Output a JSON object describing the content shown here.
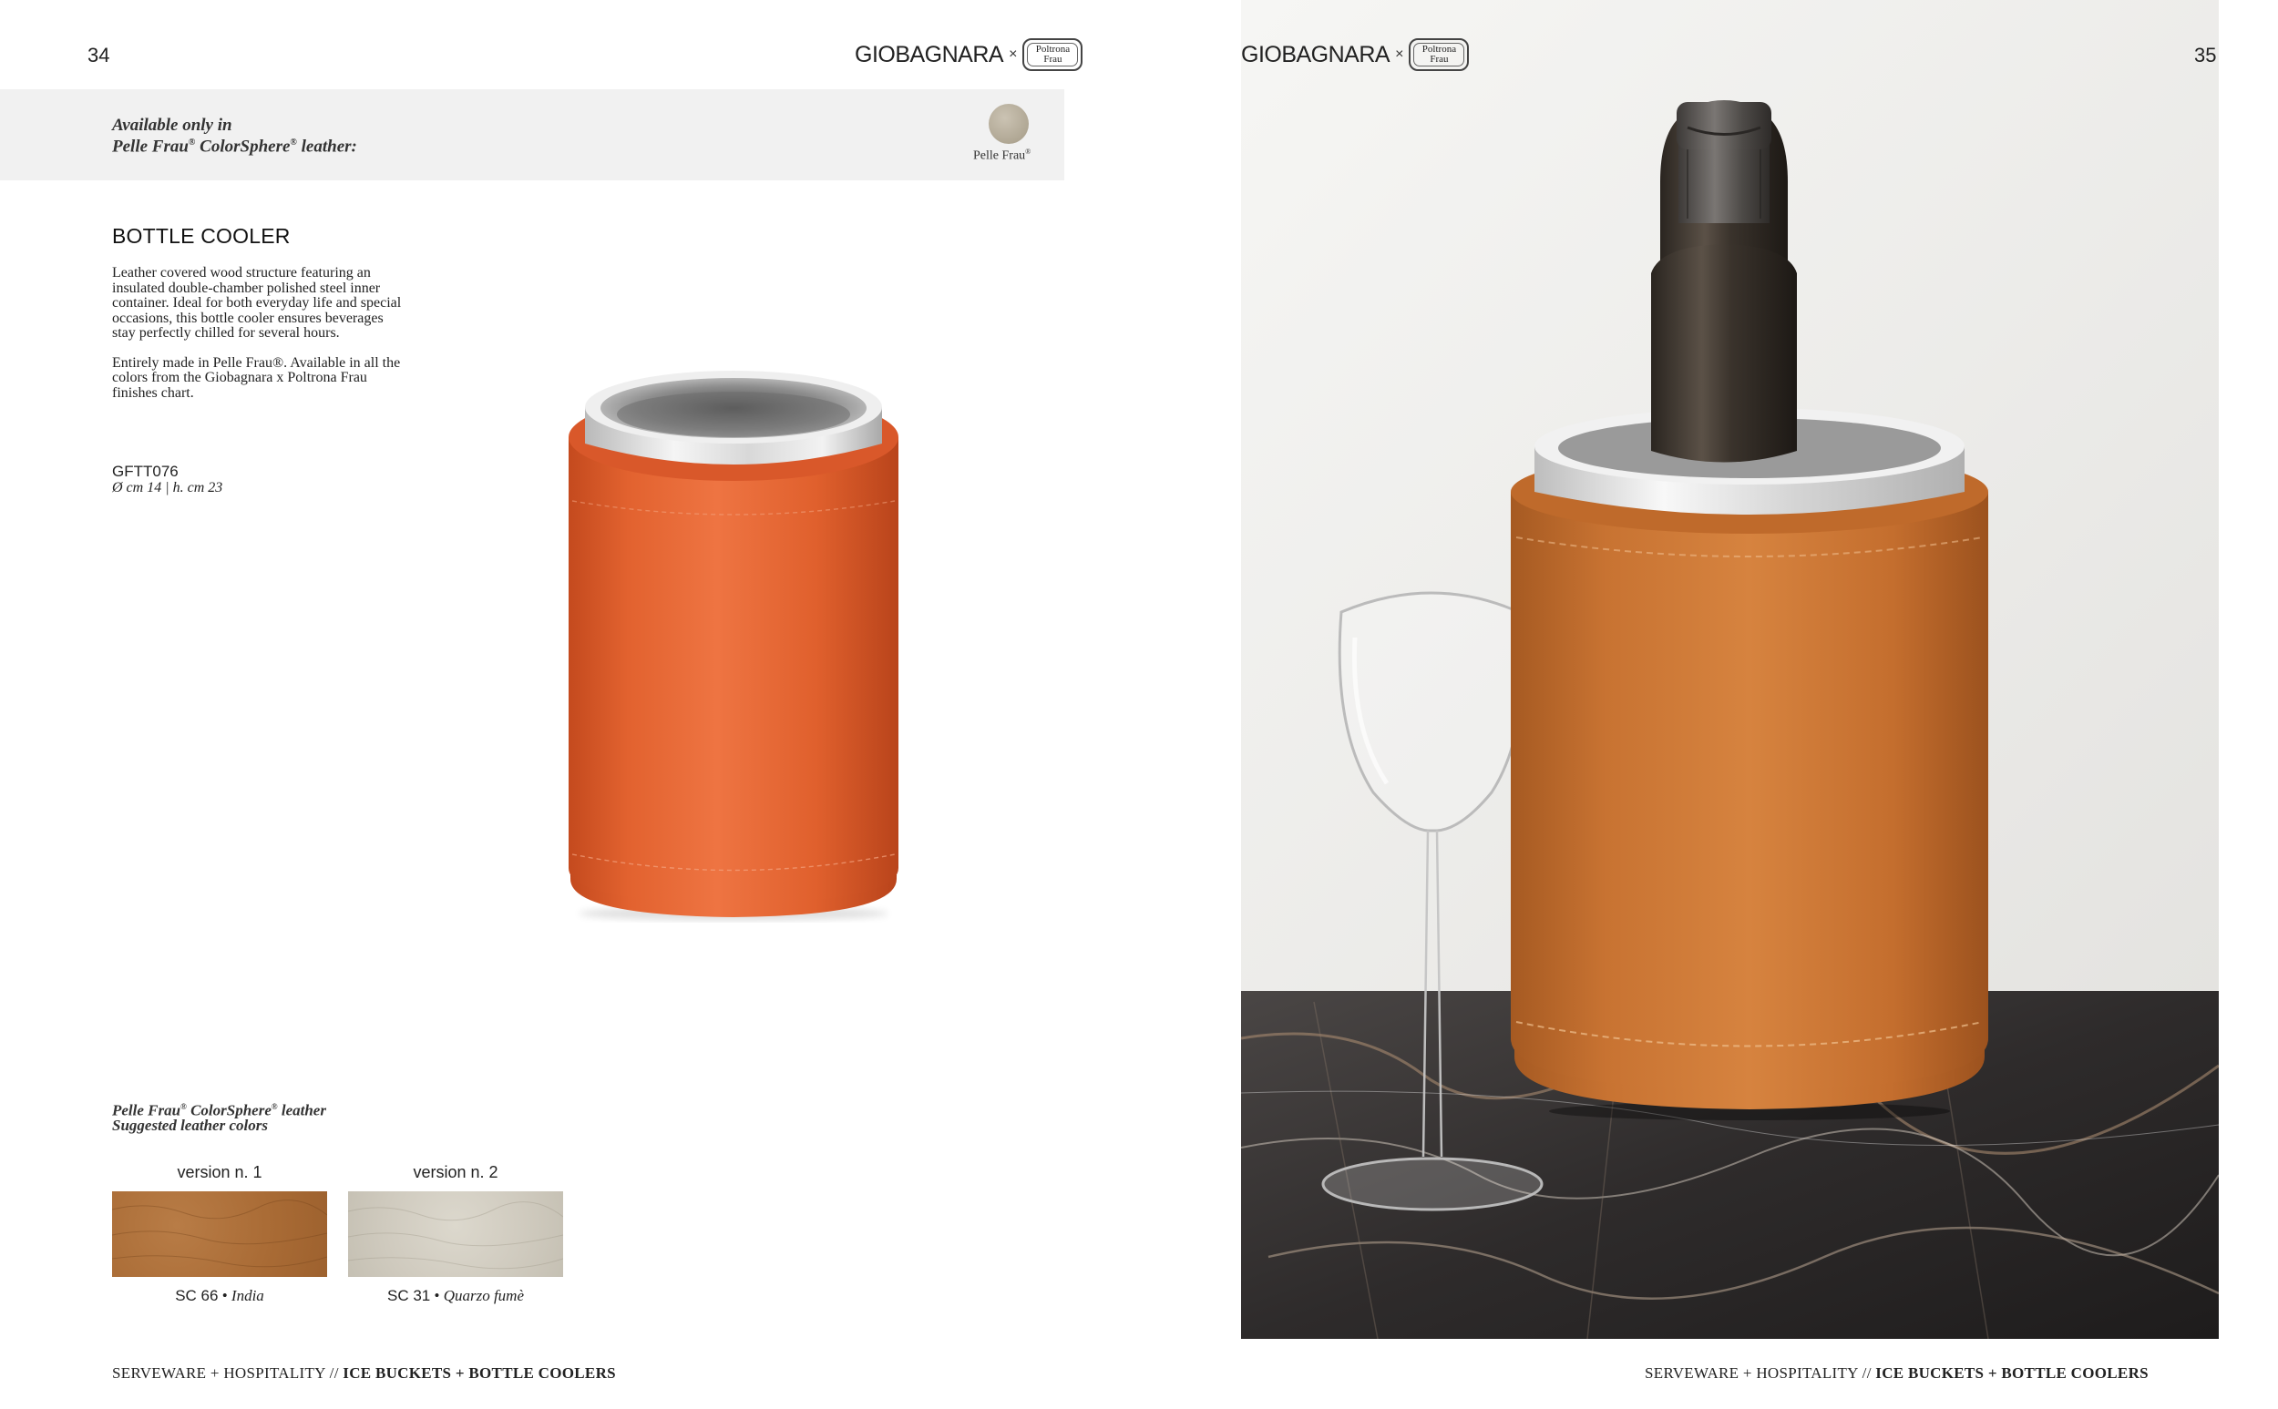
{
  "left_page": {
    "page_number": "34",
    "brand": {
      "name": "GIOBAGNARA",
      "x": "×",
      "partner_logo_line1": "Poltrona",
      "partner_logo_line2": "Frau"
    },
    "availability": {
      "line1": "Available only in",
      "line2_a": "Pelle Frau",
      "line2_reg": "®",
      "line2_b": " ColorSphere",
      "line2_reg2": "®",
      "line2_c": " leather:",
      "swatch_label": "Pelle Frau",
      "swatch_label_reg": "®",
      "swatch_color": "#b3aa97"
    },
    "product": {
      "title": "BOTTLE COOLER",
      "description_1": "Leather covered wood structure featuring an insulated double-chamber polished steel inner container. Ideal for both everyday life and special occasions, this bottle cooler ensures beverages stay perfectly chilled for several hours.",
      "description_2": "Entirely made in Pelle Frau®. Available in all the colors from the Giobagnara x Poltrona Frau finishes chart.",
      "code": "GFTT076",
      "dimensions": "Ø cm 14 | h. cm 23",
      "leather_color": "#e2622f"
    },
    "leather_section": {
      "heading_a": "Pelle Frau",
      "heading_reg": "®",
      "heading_b": " ColorSphere",
      "heading_reg2": "®",
      "heading_c": " leather",
      "heading_line2": "Suggested leather colors",
      "versions": [
        {
          "label": "version n. 1",
          "code": "SC 66",
          "sep": " • ",
          "name": "India",
          "color": "#ab6d37"
        },
        {
          "label": "version n. 2",
          "code": "SC 31",
          "sep": " • ",
          "name": "Quarzo fumè",
          "color": "#d1ccc0"
        }
      ]
    },
    "footer": {
      "regular": "SERVEWARE + HOSPITALITY // ",
      "bold": "ICE BUCKETS + BOTTLE COOLERS"
    }
  },
  "right_page": {
    "page_number": "35",
    "brand": {
      "name": "GIOBAGNARA",
      "x": "×",
      "partner_logo_line1": "Poltrona",
      "partner_logo_line2": "Frau"
    },
    "photo_leather_color": "#c87332",
    "footer": {
      "regular": "SERVEWARE + HOSPITALITY // ",
      "bold": "ICE BUCKETS + BOTTLE COOLERS"
    }
  }
}
